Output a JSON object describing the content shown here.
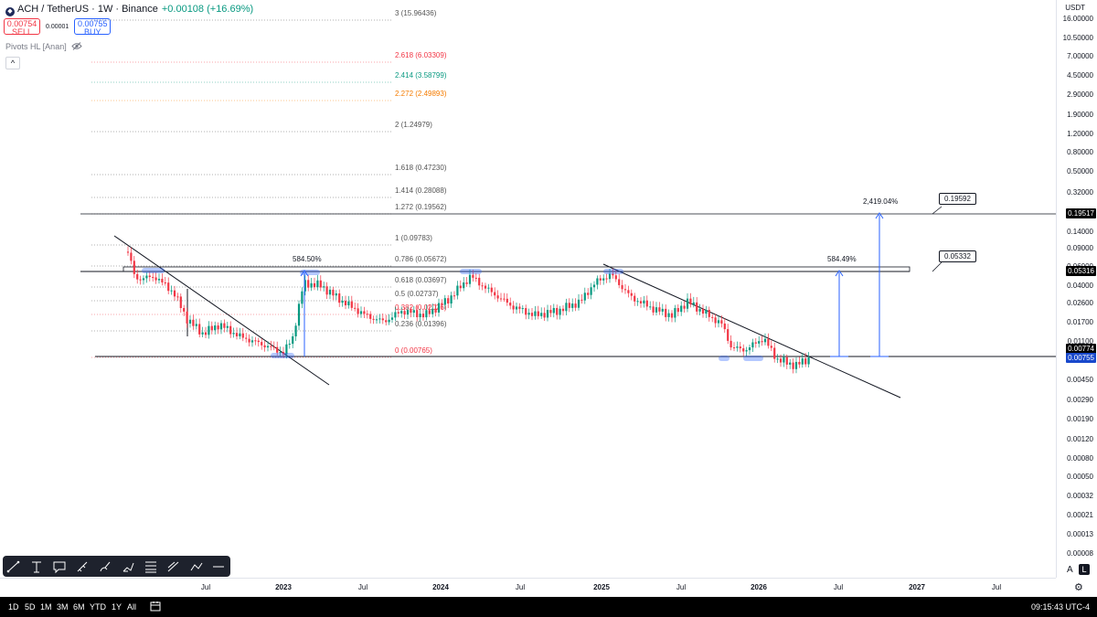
{
  "legend": {
    "symbol": "ACH / TetherUS · 1W · Binance",
    "change": "+0.00108 (+16.69%)",
    "sell_price": "0.00754",
    "sell_label": "SELL",
    "spread": "0.00001",
    "buy_price": "0.00755",
    "buy_label": "BUY",
    "indicator": "Pivots HL [Anan]",
    "collapse_glyph": "^"
  },
  "price_axis": {
    "currency": "USDT",
    "labels": [
      "16.00000",
      "10.50000",
      "7.00000",
      "4.50000",
      "2.90000",
      "1.90000",
      "1.20000",
      "0.80000",
      "0.50000",
      "0.32000",
      "0.20000",
      "0.14000",
      "0.09000",
      "0.06000",
      "0.04000",
      "0.02600",
      "0.01700",
      "0.01100",
      "0.00700",
      "0.00450",
      "0.00290",
      "0.00190",
      "0.00120",
      "0.00080",
      "0.00050",
      "0.00032",
      "0.00021",
      "0.00013",
      "0.00008"
    ],
    "tags": [
      {
        "text": "0.19517",
        "color": "#000000"
      },
      {
        "text": "0.05316",
        "color": "#000000"
      },
      {
        "text": "0.00774",
        "color": "#000000"
      },
      {
        "text": "0.00755",
        "color": "#1848cc"
      }
    ]
  },
  "time_axis": {
    "labels": [
      {
        "text": "Jul",
        "year": false
      },
      {
        "text": "2023",
        "year": true
      },
      {
        "text": "Jul",
        "year": false
      },
      {
        "text": "2024",
        "year": true
      },
      {
        "text": "Jul",
        "year": false
      },
      {
        "text": "2025",
        "year": true
      },
      {
        "text": "Jul",
        "year": false
      },
      {
        "text": "2026",
        "year": true
      },
      {
        "text": "Jul",
        "year": false
      },
      {
        "text": "2027",
        "year": true
      },
      {
        "text": "Jul",
        "year": false
      }
    ]
  },
  "fib_levels": [
    {
      "label": "3 (15.96436)",
      "color": "#555555"
    },
    {
      "label": "2.618 (6.03309)",
      "color": "#f23645"
    },
    {
      "label": "2.414 (3.58799)",
      "color": "#089981"
    },
    {
      "label": "2.272 (2.49893)",
      "color": "#f57c00"
    },
    {
      "label": "2 (1.24979)",
      "color": "#555555"
    },
    {
      "label": "1.618 (0.47230)",
      "color": "#555555"
    },
    {
      "label": "1.414 (0.28088)",
      "color": "#555555"
    },
    {
      "label": "1.272 (0.19562)",
      "color": "#555555"
    },
    {
      "label": "1 (0.09783)",
      "color": "#555555"
    },
    {
      "label": "0.786 (0.05672)",
      "color": "#555555"
    },
    {
      "label": "0.618 (0.03697)",
      "color": "#555555"
    },
    {
      "label": "0.5 (0.02737)",
      "color": "#555555"
    },
    {
      "label": "0.382 (0.02026)",
      "color": "#f23645"
    },
    {
      "label": "0.236 (0.01396)",
      "color": "#555555"
    },
    {
      "label": "0 (0.00765)",
      "color": "#f23645"
    }
  ],
  "annotations": {
    "pct_left": "584.50%",
    "pct_mid": "584.49%",
    "pct_right": "2,419.04%",
    "callout_top": "0.19592",
    "callout_mid": "0.05332"
  },
  "toolbar": {
    "tools": [
      "trend-line-tool",
      "text-tool",
      "callout-tool",
      "path-tool",
      "brush-tool",
      "highlighter-tool",
      "fib-tool",
      "pattern-tool",
      "polyline-tool",
      "horizontal-line-tool"
    ]
  },
  "bottom_bar": {
    "ranges": [
      "1D",
      "5D",
      "1M",
      "3M",
      "6M",
      "YTD",
      "1Y",
      "All"
    ],
    "clock": "09:15:43 UTC-4"
  },
  "scale_buttons": {
    "auto": "A",
    "log": "L"
  },
  "colors": {
    "up": "#089981",
    "down": "#f23645",
    "accent": "#2962ff"
  }
}
